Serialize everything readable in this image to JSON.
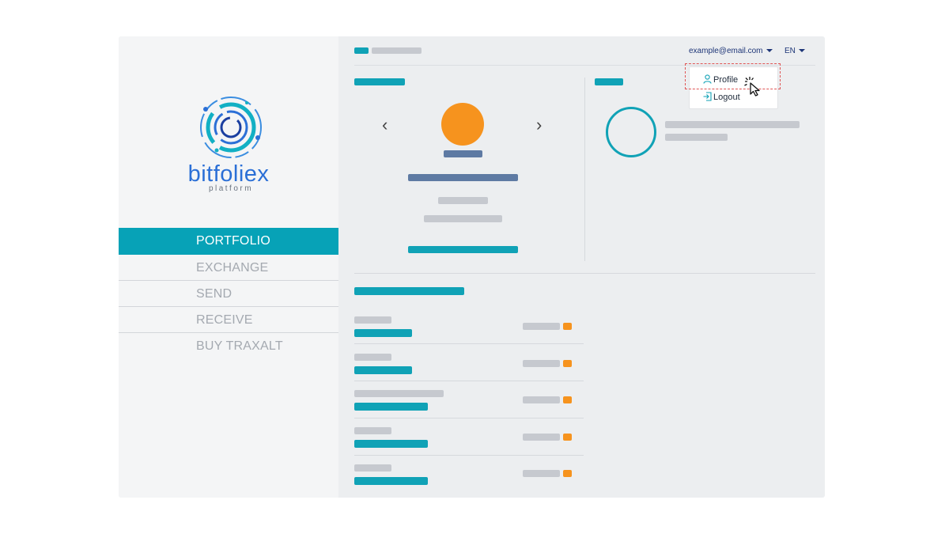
{
  "sidebar": {
    "brand": "bitfoliex",
    "brand_sub": "platform",
    "nav": [
      {
        "label": "PORTFOLIO",
        "active": true
      },
      {
        "label": "EXCHANGE",
        "active": false
      },
      {
        "label": "SEND",
        "active": false
      },
      {
        "label": "RECEIVE",
        "active": false
      },
      {
        "label": "BUY TRAXALT",
        "active": false
      }
    ]
  },
  "header": {
    "email": "example@email.com",
    "language": "EN"
  },
  "user_menu": {
    "items": [
      {
        "label": "Profile",
        "icon": "user-icon"
      },
      {
        "label": "Logout",
        "icon": "logout-icon"
      }
    ]
  },
  "carousel": {
    "prev_icon": "chevron-left-icon",
    "next_icon": "chevron-right-icon",
    "prev_glyph": "‹",
    "next_glyph": "›"
  },
  "colors": {
    "accent": "#10a2b6",
    "brand": "#2b6fd6",
    "orange": "#f6931e",
    "navy_text": "#1d3577",
    "placeholder": "#c6c9cf"
  },
  "cursor_icon": "pointer-click-icon"
}
